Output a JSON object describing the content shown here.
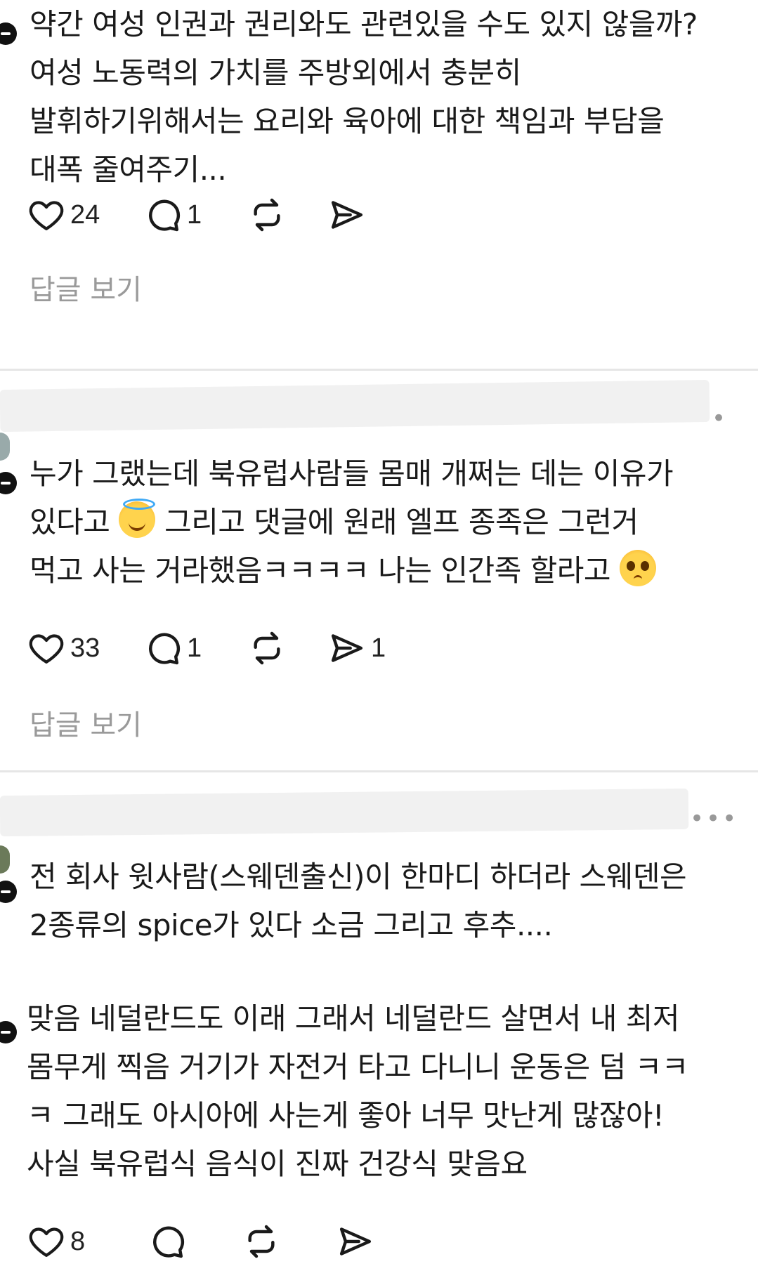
{
  "comments": [
    {
      "text": "약간 여성 인권과 권리와도 관련있을 수도 있지 않을까?\n여성 노동력의 가치를 주방외에서 충분히\n발휘하기위해서는 요리와 육아에 대한 책임과 부담을\n대폭 줄여주기...",
      "likes": "24",
      "comments": "1",
      "shares": "",
      "view_replies": "답글 보기"
    },
    {
      "text_line1": "누가 그랬는데 북유럽사람들 몸매 개쩌는 데는 이유가",
      "text_line2a": "있다고 ",
      "text_line2b": " 그리고 댓글에 원래 엘프 종족은 그런거",
      "text_line3a": "먹고 사는 거라했음ㅋㅋㅋㅋ 나는 인간족 할라고 ",
      "likes": "33",
      "comments": "1",
      "shares": "1",
      "view_replies": "답글 보기",
      "more": "•"
    },
    {
      "text": "전 회사 윗사람(스웨덴출신)이 한마디 하더라 스웨덴은\n2종류의 spice가 있다 소금 그리고 후추....",
      "more": "•••"
    },
    {
      "text": "맞음 네덜란드도 이래 그래서 네덜란드 살면서 내 최저\n몸무게 찍음 거기가 자전거 타고 다니니 운동은 덤 ㅋㅋ\nㅋ 그래도 아시아에 사는게 좋아 너무 맛난게 많잖아!\n사실 북유럽식 음식이 진짜 건강식 맞음요",
      "likes": "8"
    }
  ],
  "icons": {
    "like": "heart-icon",
    "comment": "comment-bubble-icon",
    "repost": "repost-icon",
    "share": "send-icon",
    "emoji1": "smiling-face-with-halo-emoji",
    "emoji2": "pleading-face-emoji"
  }
}
